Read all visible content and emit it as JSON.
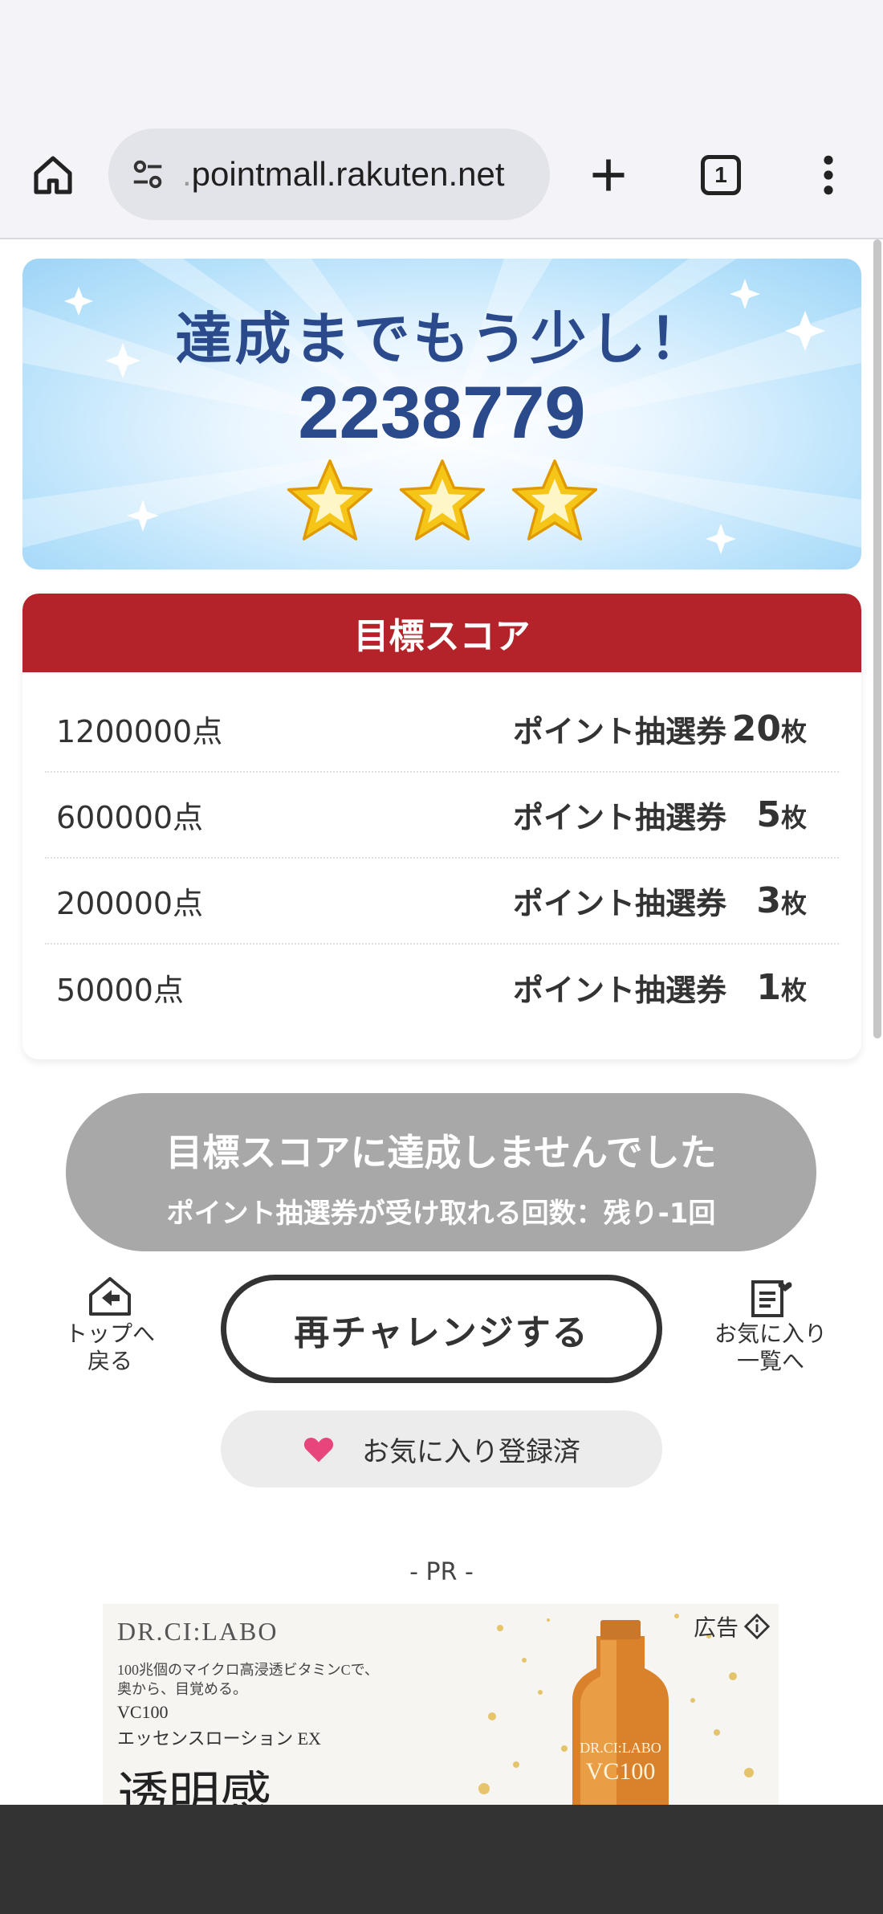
{
  "browser": {
    "url_prefix": ".",
    "url_host": "pointmall.rakuten.net",
    "tab_count": "1"
  },
  "hero": {
    "title": "達成までもう少し！",
    "score": "2238779",
    "stars": 3
  },
  "goals": {
    "header": "目標スコア",
    "rows": [
      {
        "score": "1200000点",
        "reward": "ポイント抽選券",
        "count": "20",
        "unit": "枚"
      },
      {
        "score": "600000点",
        "reward": "ポイント抽選券",
        "count": "5",
        "unit": "枚"
      },
      {
        "score": "200000点",
        "reward": "ポイント抽選券",
        "count": "3",
        "unit": "枚"
      },
      {
        "score": "50000点",
        "reward": "ポイント抽選券",
        "count": "1",
        "unit": "枚"
      }
    ]
  },
  "result": {
    "main": "目標スコアに達成しませんでした",
    "sub": "ポイント抽選券が受け取れる回数：残り-1回"
  },
  "actions": {
    "top_line1": "トップへ",
    "top_line2": "戻る",
    "retry": "再チャレンジする",
    "fav_line1": "お気に入り",
    "fav_line2": "一覧へ",
    "favorite_status": "お気に入り登録済"
  },
  "ad": {
    "pr_label": "- PR -",
    "badge": "広告",
    "brand": "DR.CI:LABO",
    "desc_line1": "100兆個のマイクロ高浸透ビタミンCで、",
    "desc_line2": "奥から、目覚める。",
    "product_line1": "VC100",
    "product_line2": "エッセンスローション EX",
    "headline": "透明感",
    "bottle_brand": "DR.CI:LABO",
    "bottle_label": "VC100"
  },
  "colors": {
    "accent_red": "#b5232a",
    "hero_text": "#2a4a8c",
    "fail_gray": "#a8a8a8",
    "heart": "#e8457c",
    "star": "#f5c518"
  }
}
